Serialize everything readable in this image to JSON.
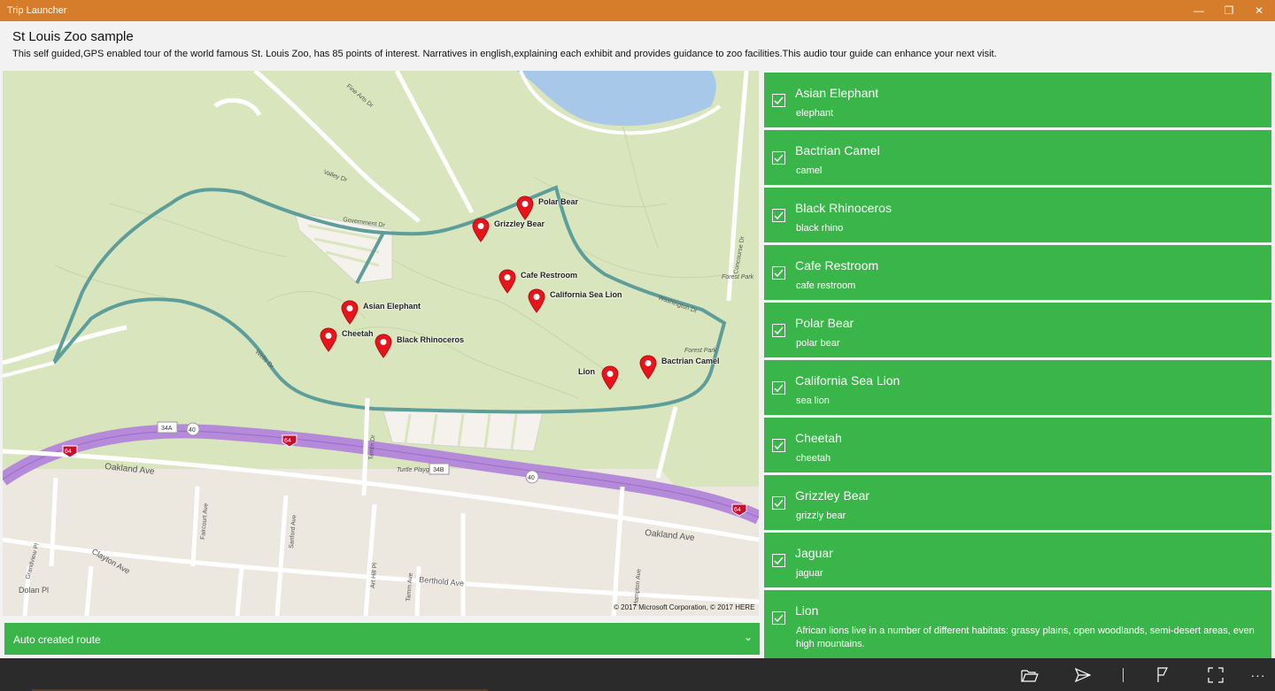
{
  "window": {
    "title": "Trip Launcher",
    "minimize_glyph": "—",
    "maximize_glyph": "❐",
    "close_glyph": "✕"
  },
  "header": {
    "title": "St Louis Zoo sample",
    "description": "This self guided,GPS enabled tour of the world famous St. Louis Zoo, has 85 points of interest. Narratives in english,explaining each exhibit and provides guidance to zoo facilities.This audio tour guide can enhance your next visit."
  },
  "map": {
    "copyright": "© 2017 Microsoft Corporation, © 2017 HERE",
    "pins": [
      {
        "label": "Polar Bear"
      },
      {
        "label": "Grizzley Bear"
      },
      {
        "label": "Cafe Restroom"
      },
      {
        "label": "California Sea Lion"
      },
      {
        "label": "Asian Elephant"
      },
      {
        "label": "Cheetah"
      },
      {
        "label": "Black Rhinoceros"
      },
      {
        "label": "Bactrian Camel"
      },
      {
        "label": "Lion"
      }
    ],
    "street_labels": [
      "Oakland Ave",
      "Oakland Ave",
      "Clayton Ave",
      "Dolan Pl",
      "Berthold Ave",
      "Fine Arts Dr",
      "Valley Dr",
      "Government Dr",
      "Wells Dr",
      "Washington Dr",
      "Concourse Dr",
      "Forest Park",
      "Forest Park",
      "Turtle Playground",
      "Faircourt Ave",
      "Sanford Ave",
      "Art Hill Pl",
      "Tamm Ave",
      "Hampton Ave",
      "Grandview Pl",
      "Tamm Dr"
    ],
    "shields": [
      "34A",
      "40",
      "64",
      "64",
      "34B",
      "40",
      "64"
    ]
  },
  "route_selector": {
    "label": "Auto created route",
    "chevron": "⌄"
  },
  "items": [
    {
      "title": "Asian Elephant",
      "subtitle": "elephant",
      "checked": true
    },
    {
      "title": "Bactrian Camel",
      "subtitle": "camel",
      "checked": true
    },
    {
      "title": "Black Rhinoceros",
      "subtitle": "black rhino",
      "checked": true
    },
    {
      "title": "Cafe Restroom",
      "subtitle": "cafe restroom",
      "checked": true
    },
    {
      "title": "Polar Bear",
      "subtitle": "polar bear",
      "checked": true
    },
    {
      "title": "California Sea Lion",
      "subtitle": "sea lion",
      "checked": true
    },
    {
      "title": "Cheetah",
      "subtitle": "cheetah",
      "checked": true
    },
    {
      "title": "Grizzley Bear",
      "subtitle": "grizzly bear",
      "checked": true
    },
    {
      "title": "Jaguar",
      "subtitle": "jaguar",
      "checked": true
    },
    {
      "title": "Lion",
      "subtitle": "African lions live in a number of different habitats: grassy plains, open woodlands, semi-desert areas, even high mountains.",
      "checked": true
    }
  ],
  "app_bar": {
    "buttons": [
      "open-folder-icon",
      "send-icon",
      "separator",
      "flag-icon",
      "fullscreen-icon",
      "more-icon"
    ],
    "more_glyph": "···"
  },
  "colors": {
    "titlebar": "#d67d2b",
    "accent_green": "#3ab54a",
    "pin_red": "#e8141b",
    "route": "#5d9e9a",
    "highway": "#b48ad9"
  }
}
